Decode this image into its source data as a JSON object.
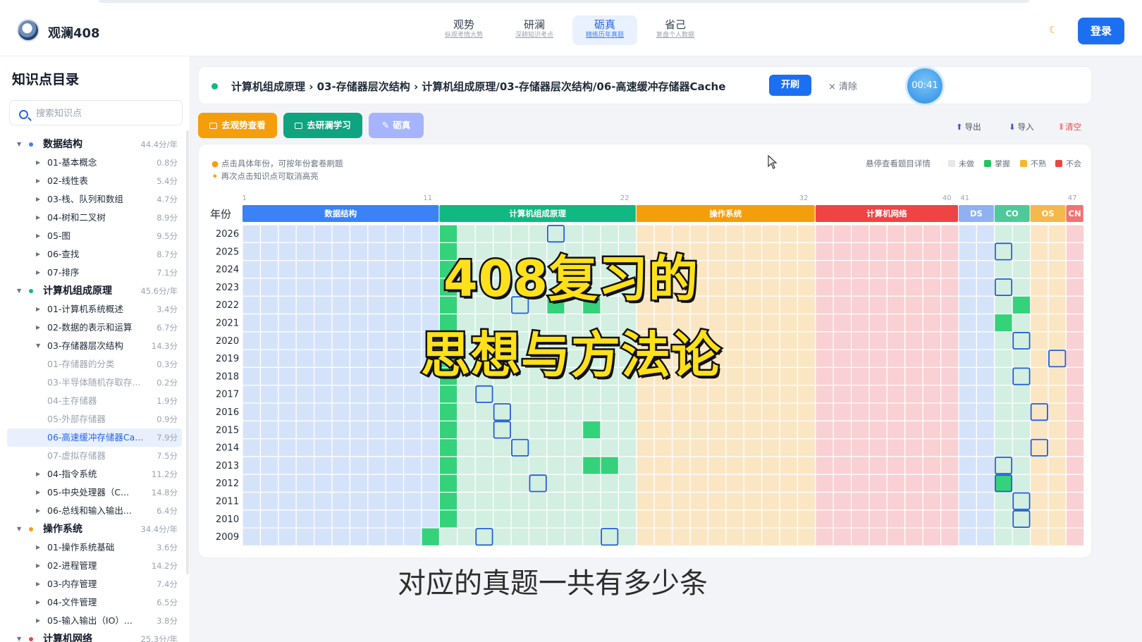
{
  "app": {
    "brand": "观澜408"
  },
  "nav": {
    "items": [
      {
        "title": "观势",
        "sub": "纵观考情大势"
      },
      {
        "title": "研澜",
        "sub": "深耕知识考点"
      },
      {
        "title": "砺真",
        "sub": "精练历年真题"
      },
      {
        "title": "省己",
        "sub": "复盘个人数据"
      }
    ],
    "active_index": 2,
    "login": "登录"
  },
  "sidebar": {
    "title": "知识点目录",
    "search_placeholder": "搜索知识点",
    "items": [
      {
        "label": "数据结构",
        "value": "44.4分/年",
        "level": 0,
        "dot": "#3b82f6",
        "expanded": true
      },
      {
        "label": "01-基本概念",
        "value": "0.8分",
        "level": 1
      },
      {
        "label": "02-线性表",
        "value": "5.4分",
        "level": 1
      },
      {
        "label": "03-栈、队列和数组",
        "value": "4.7分",
        "level": 1
      },
      {
        "label": "04-树和二叉树",
        "value": "8.9分",
        "level": 1
      },
      {
        "label": "05-图",
        "value": "9.5分",
        "level": 1
      },
      {
        "label": "06-查找",
        "value": "8.7分",
        "level": 1
      },
      {
        "label": "07-排序",
        "value": "7.1分",
        "level": 1
      },
      {
        "label": "计算机组成原理",
        "value": "45.6分/年",
        "level": 0,
        "dot": "#10b981",
        "expanded": true
      },
      {
        "label": "01-计算机系统概述",
        "value": "3.4分",
        "level": 1
      },
      {
        "label": "02-数据的表示和运算",
        "value": "6.7分",
        "level": 1
      },
      {
        "label": "03-存储器层次结构",
        "value": "14.3分",
        "level": 1,
        "expanded": true
      },
      {
        "label": "01-存储器的分类",
        "value": "0.3分",
        "level": 2
      },
      {
        "label": "03-半导体随机存取存...",
        "value": "0.2分",
        "level": 2
      },
      {
        "label": "04-主存储器",
        "value": "1.9分",
        "level": 2
      },
      {
        "label": "05-外部存储器",
        "value": "0.9分",
        "level": 2
      },
      {
        "label": "06-高速缓冲存储器Ca...",
        "value": "7.9分",
        "level": 2,
        "selected": true
      },
      {
        "label": "07-虚拟存储器",
        "value": "7.5分",
        "level": 2
      },
      {
        "label": "04-指令系统",
        "value": "11.2分",
        "level": 1
      },
      {
        "label": "05-中央处理器（C...",
        "value": "14.8分",
        "level": 1
      },
      {
        "label": "06-总线和输入输出...",
        "value": "6.4分",
        "level": 1
      },
      {
        "label": "操作系统",
        "value": "34.4分/年",
        "level": 0,
        "dot": "#f59e0b",
        "expanded": true
      },
      {
        "label": "01-操作系统基础",
        "value": "3.6分",
        "level": 1
      },
      {
        "label": "02-进程管理",
        "value": "14.2分",
        "level": 1
      },
      {
        "label": "03-内存管理",
        "value": "7.4分",
        "level": 1
      },
      {
        "label": "04-文件管理",
        "value": "6.5分",
        "level": 1
      },
      {
        "label": "05-输入输出（IO）...",
        "value": "3.8分",
        "level": 1
      },
      {
        "label": "计算机网络",
        "value": "25.3分/年",
        "level": 0,
        "dot": "#ef4444",
        "expanded": true
      }
    ]
  },
  "breadcrumb": {
    "text": "计算机组成原理 › 03-存储器层次结构 › 计算机组成原理/03-存储器层次结构/06-高速缓冲存储器Cache",
    "start": "开刷",
    "clear": "× 清除",
    "timer": "00:41"
  },
  "actions": {
    "trend": "去观势查看",
    "study": "去研澜学习",
    "practice": "砺真",
    "export": "导出",
    "import": "导入",
    "clear_all": "清空"
  },
  "grid": {
    "tip1": "点击具体年份，可按年份套卷刷题",
    "tip2": "再次点击知识点可取消高亮",
    "hover_hint": "悬停查看题目详情",
    "year_label": "年份",
    "legend": [
      {
        "label": "未做",
        "color": "#e5e7eb"
      },
      {
        "label": "掌握",
        "color": "#22c55e"
      },
      {
        "label": "不熟",
        "color": "#f5b82e"
      },
      {
        "label": "不会",
        "color": "#ef4444"
      }
    ],
    "col_numbers": [
      "1",
      "11",
      "22",
      "32",
      "40",
      "41",
      "47"
    ],
    "col_number_positions": [
      1,
      11,
      22,
      32,
      40,
      41,
      47
    ],
    "subjects": [
      {
        "name": "数据结构",
        "start": 1,
        "end": 11,
        "color": "#3b82f6",
        "cell": "#d5e3fa"
      },
      {
        "name": "计算机组成原理",
        "start": 12,
        "end": 22,
        "color": "#10b981",
        "cell": "#d2efe2"
      },
      {
        "name": "操作系统",
        "start": 23,
        "end": 32,
        "color": "#f59e0b",
        "cell": "#fbe6c4"
      },
      {
        "name": "计算机网络",
        "start": 33,
        "end": 40,
        "color": "#ef4444",
        "cell": "#f9d0d3"
      },
      {
        "name": "DS",
        "start": 41,
        "end": 42,
        "color": "#8fb1f0",
        "cell": "#d5e3fa"
      },
      {
        "name": "CO",
        "start": 43,
        "end": 44,
        "color": "#4fc99a",
        "cell": "#d2efe2"
      },
      {
        "name": "OS",
        "start": 45,
        "end": 46,
        "color": "#f5b84d",
        "cell": "#fbe6c4"
      },
      {
        "name": "CN",
        "start": 47,
        "end": 47,
        "color": "#f07474",
        "cell": "#f9d0d3"
      }
    ],
    "years": [
      "2026",
      "2025",
      "2024",
      "2023",
      "2022",
      "2021",
      "2020",
      "2019",
      "2018",
      "2017",
      "2016",
      "2015",
      "2014",
      "2013",
      "2012",
      "2011",
      "2010",
      "2009"
    ],
    "mastered": [
      [
        "2026",
        12
      ],
      [
        "2025",
        12
      ],
      [
        "2024",
        12
      ],
      [
        "2023",
        12
      ],
      [
        "2022",
        12
      ],
      [
        "2022",
        18
      ],
      [
        "2022",
        20
      ],
      [
        "2021",
        12
      ],
      [
        "2020",
        12
      ],
      [
        "2019",
        12
      ],
      [
        "2018",
        12
      ],
      [
        "2017",
        12
      ],
      [
        "2016",
        12
      ],
      [
        "2015",
        12
      ],
      [
        "2015",
        20
      ],
      [
        "2014",
        12
      ],
      [
        "2013",
        12
      ],
      [
        "2013",
        20
      ],
      [
        "2013",
        21
      ],
      [
        "2012",
        12
      ],
      [
        "2011",
        12
      ],
      [
        "2010",
        12
      ],
      [
        "2009",
        11
      ],
      [
        "2022",
        44
      ],
      [
        "2021",
        43
      ],
      [
        "2012",
        43
      ]
    ],
    "highlighted": [
      [
        "2026",
        18
      ],
      [
        "2022",
        16
      ],
      [
        "2017",
        14
      ],
      [
        "2016",
        15
      ],
      [
        "2015",
        15
      ],
      [
        "2014",
        16
      ],
      [
        "2012",
        17
      ],
      [
        "2009",
        14
      ],
      [
        "2009",
        21
      ],
      [
        "2025",
        43
      ],
      [
        "2023",
        43
      ],
      [
        "2020",
        44
      ],
      [
        "2019",
        46
      ],
      [
        "2018",
        44
      ],
      [
        "2016",
        45
      ],
      [
        "2014",
        45
      ],
      [
        "2013",
        43
      ],
      [
        "2012",
        43
      ],
      [
        "2011",
        44
      ],
      [
        "2010",
        44
      ]
    ]
  },
  "overlay": {
    "line1": "408复习的",
    "line2": "思想与方法论",
    "subtitle": "对应的真题一共有多少条"
  }
}
